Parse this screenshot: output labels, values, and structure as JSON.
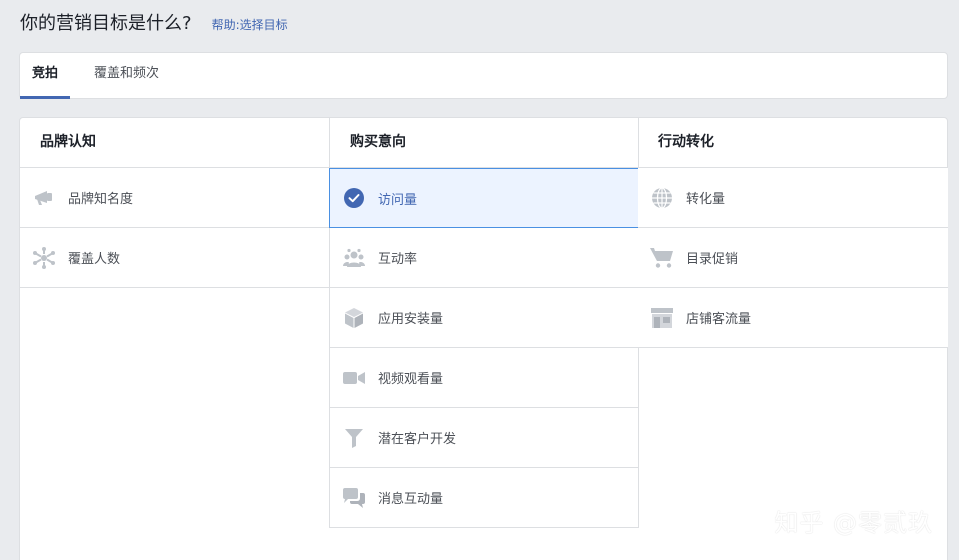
{
  "header": {
    "title": "你的营销目标是什么?",
    "help": "帮助:选择目标"
  },
  "tabs": [
    {
      "label": "竞拍",
      "active": true
    },
    {
      "label": "覆盖和频次",
      "active": false
    }
  ],
  "columns": [
    {
      "title": "品牌认知",
      "items": [
        {
          "label": "品牌知名度",
          "icon": "megaphone-icon"
        },
        {
          "label": "覆盖人数",
          "icon": "reach-burst-icon"
        }
      ]
    },
    {
      "title": "购买意向",
      "items": [
        {
          "label": "访问量",
          "icon": "check-circle-icon",
          "selected": true
        },
        {
          "label": "互动率",
          "icon": "people-icon"
        },
        {
          "label": "应用安装量",
          "icon": "box-icon"
        },
        {
          "label": "视频观看量",
          "icon": "video-camera-icon"
        },
        {
          "label": "潜在客户开发",
          "icon": "funnel-icon"
        },
        {
          "label": "消息互动量",
          "icon": "chat-bubbles-icon"
        }
      ]
    },
    {
      "title": "行动转化",
      "items": [
        {
          "label": "转化量",
          "icon": "globe-icon"
        },
        {
          "label": "目录促销",
          "icon": "shopping-cart-icon"
        },
        {
          "label": "店铺客流量",
          "icon": "storefront-icon"
        }
      ]
    }
  ],
  "watermark": "知乎 @零贰玖",
  "colors": {
    "accent": "#4267b2",
    "selected_bg": "#ecf3ff",
    "selected_border": "#4a90e2",
    "icon_gray": "#bec3c9"
  }
}
